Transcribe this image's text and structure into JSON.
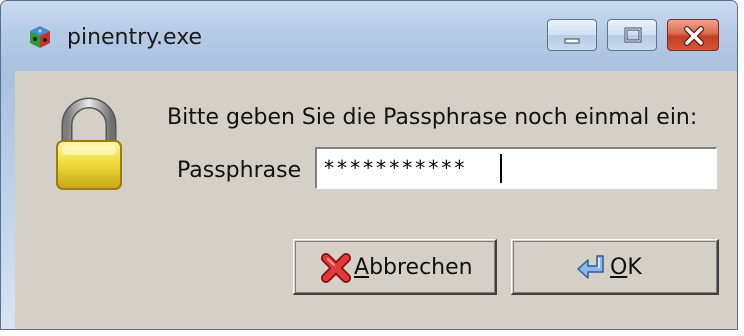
{
  "window": {
    "title": "pinentry.exe",
    "controls": {
      "minimize": "minimize",
      "maximize": "maximize",
      "close": "close"
    }
  },
  "dialog": {
    "prompt": "Bitte geben Sie die Passphrase noch einmal ein:",
    "field_label": "Passphrase",
    "field_value": "***********"
  },
  "buttons": {
    "cancel_label": "Abbrechen",
    "ok_label": "OK"
  },
  "icons": {
    "app": "pinentry-app-icon",
    "lock": "padlock-icon",
    "cancel": "red-x-icon",
    "ok": "enter-arrow-icon"
  },
  "colors": {
    "titlebar": "#b9cde5",
    "client": "#d4d0c8",
    "close_button": "#c8472b",
    "lock_gold": "#e7d22a"
  }
}
